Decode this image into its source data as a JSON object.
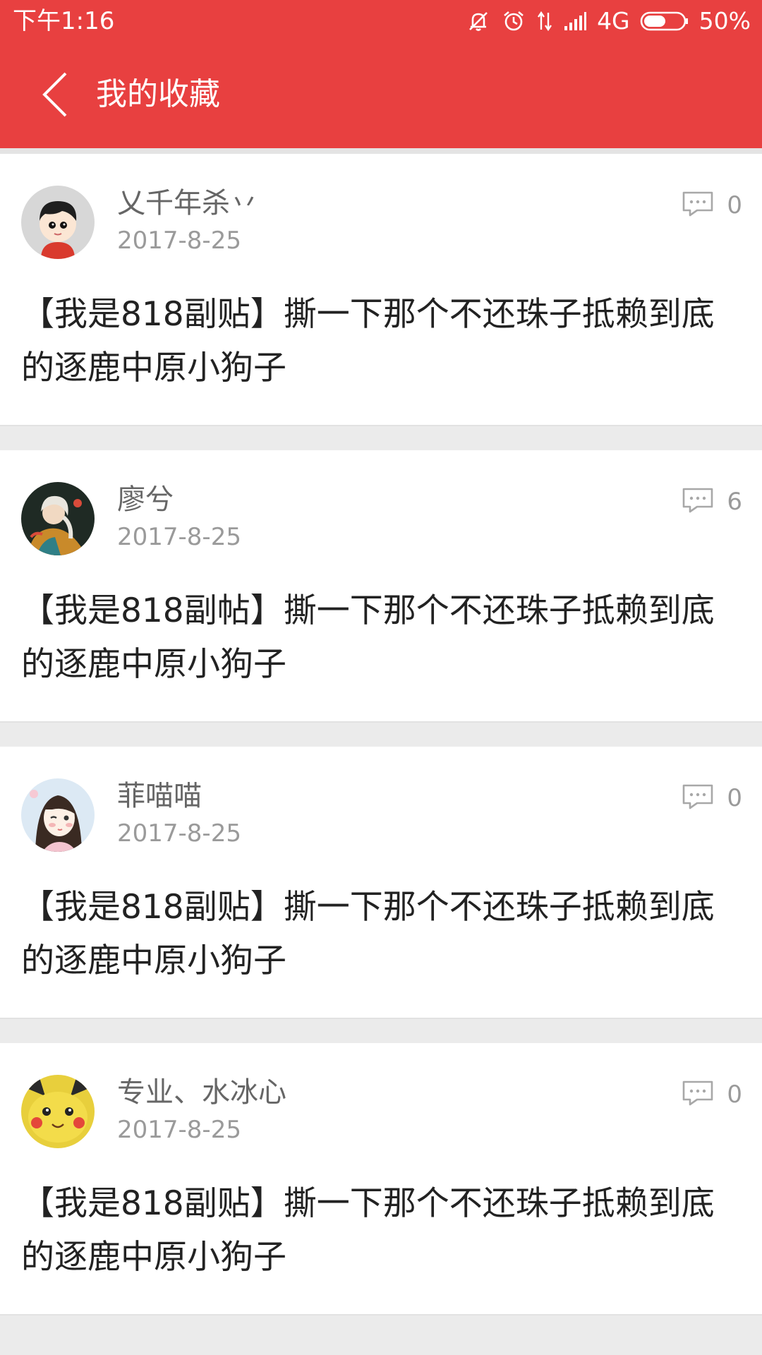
{
  "status_bar": {
    "time": "下午1:16",
    "network": "4G",
    "battery": "50%",
    "icons": [
      "mute-icon",
      "alarm-icon",
      "data-transfer-icon",
      "signal-icon",
      "battery-icon"
    ]
  },
  "app_bar": {
    "title": "我的收藏",
    "back_icon": "chevron-left-icon",
    "color": "#e84040"
  },
  "posts": [
    {
      "username": "乂千年杀丷",
      "date": "2017-8-25",
      "comments": "0",
      "title": "【我是818副贴】撕一下那个不还珠子抵赖到底的逐鹿中原小狗子",
      "avatar": "avatar-cartoon-boy"
    },
    {
      "username": "廖兮",
      "date": "2017-8-25",
      "comments": "6",
      "title": "【我是818副帖】撕一下那个不还珠子抵赖到底的逐鹿中原小狗子",
      "avatar": "avatar-painted-figure"
    },
    {
      "username": "菲喵喵",
      "date": "2017-8-25",
      "comments": "0",
      "title": "【我是818副贴】撕一下那个不还珠子抵赖到底的逐鹿中原小狗子",
      "avatar": "avatar-cartoon-girl"
    },
    {
      "username": "专业、水冰心",
      "date": "2017-8-25",
      "comments": "0",
      "title": "【我是818副贴】撕一下那个不还珠子抵赖到底的逐鹿中原小狗子",
      "avatar": "avatar-yellow-character"
    }
  ]
}
